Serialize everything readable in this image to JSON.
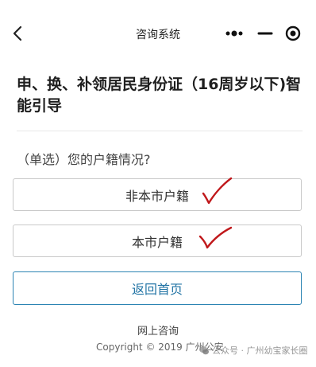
{
  "nav": {
    "title": "咨询系统",
    "back_icon": "chevron-left",
    "more_icon": "more-dots",
    "minimize_icon": "minus",
    "close_icon": "target-circle"
  },
  "guide": {
    "title": "申、换、补领居民身份证（16周岁以下)智能引导",
    "question": "（单选）您的户籍情况?"
  },
  "options": [
    {
      "label": "非本市户籍"
    },
    {
      "label": "本市户籍"
    }
  ],
  "home_button": {
    "label": "返回首页"
  },
  "footer": {
    "online_link": "网上咨询",
    "copyright": "Copyright © 2019  广州公安",
    "watermark": "公众号 · 广州幼宝家长圈"
  },
  "colors": {
    "accent": "#2274a5",
    "checkmark": "#c0181b"
  }
}
